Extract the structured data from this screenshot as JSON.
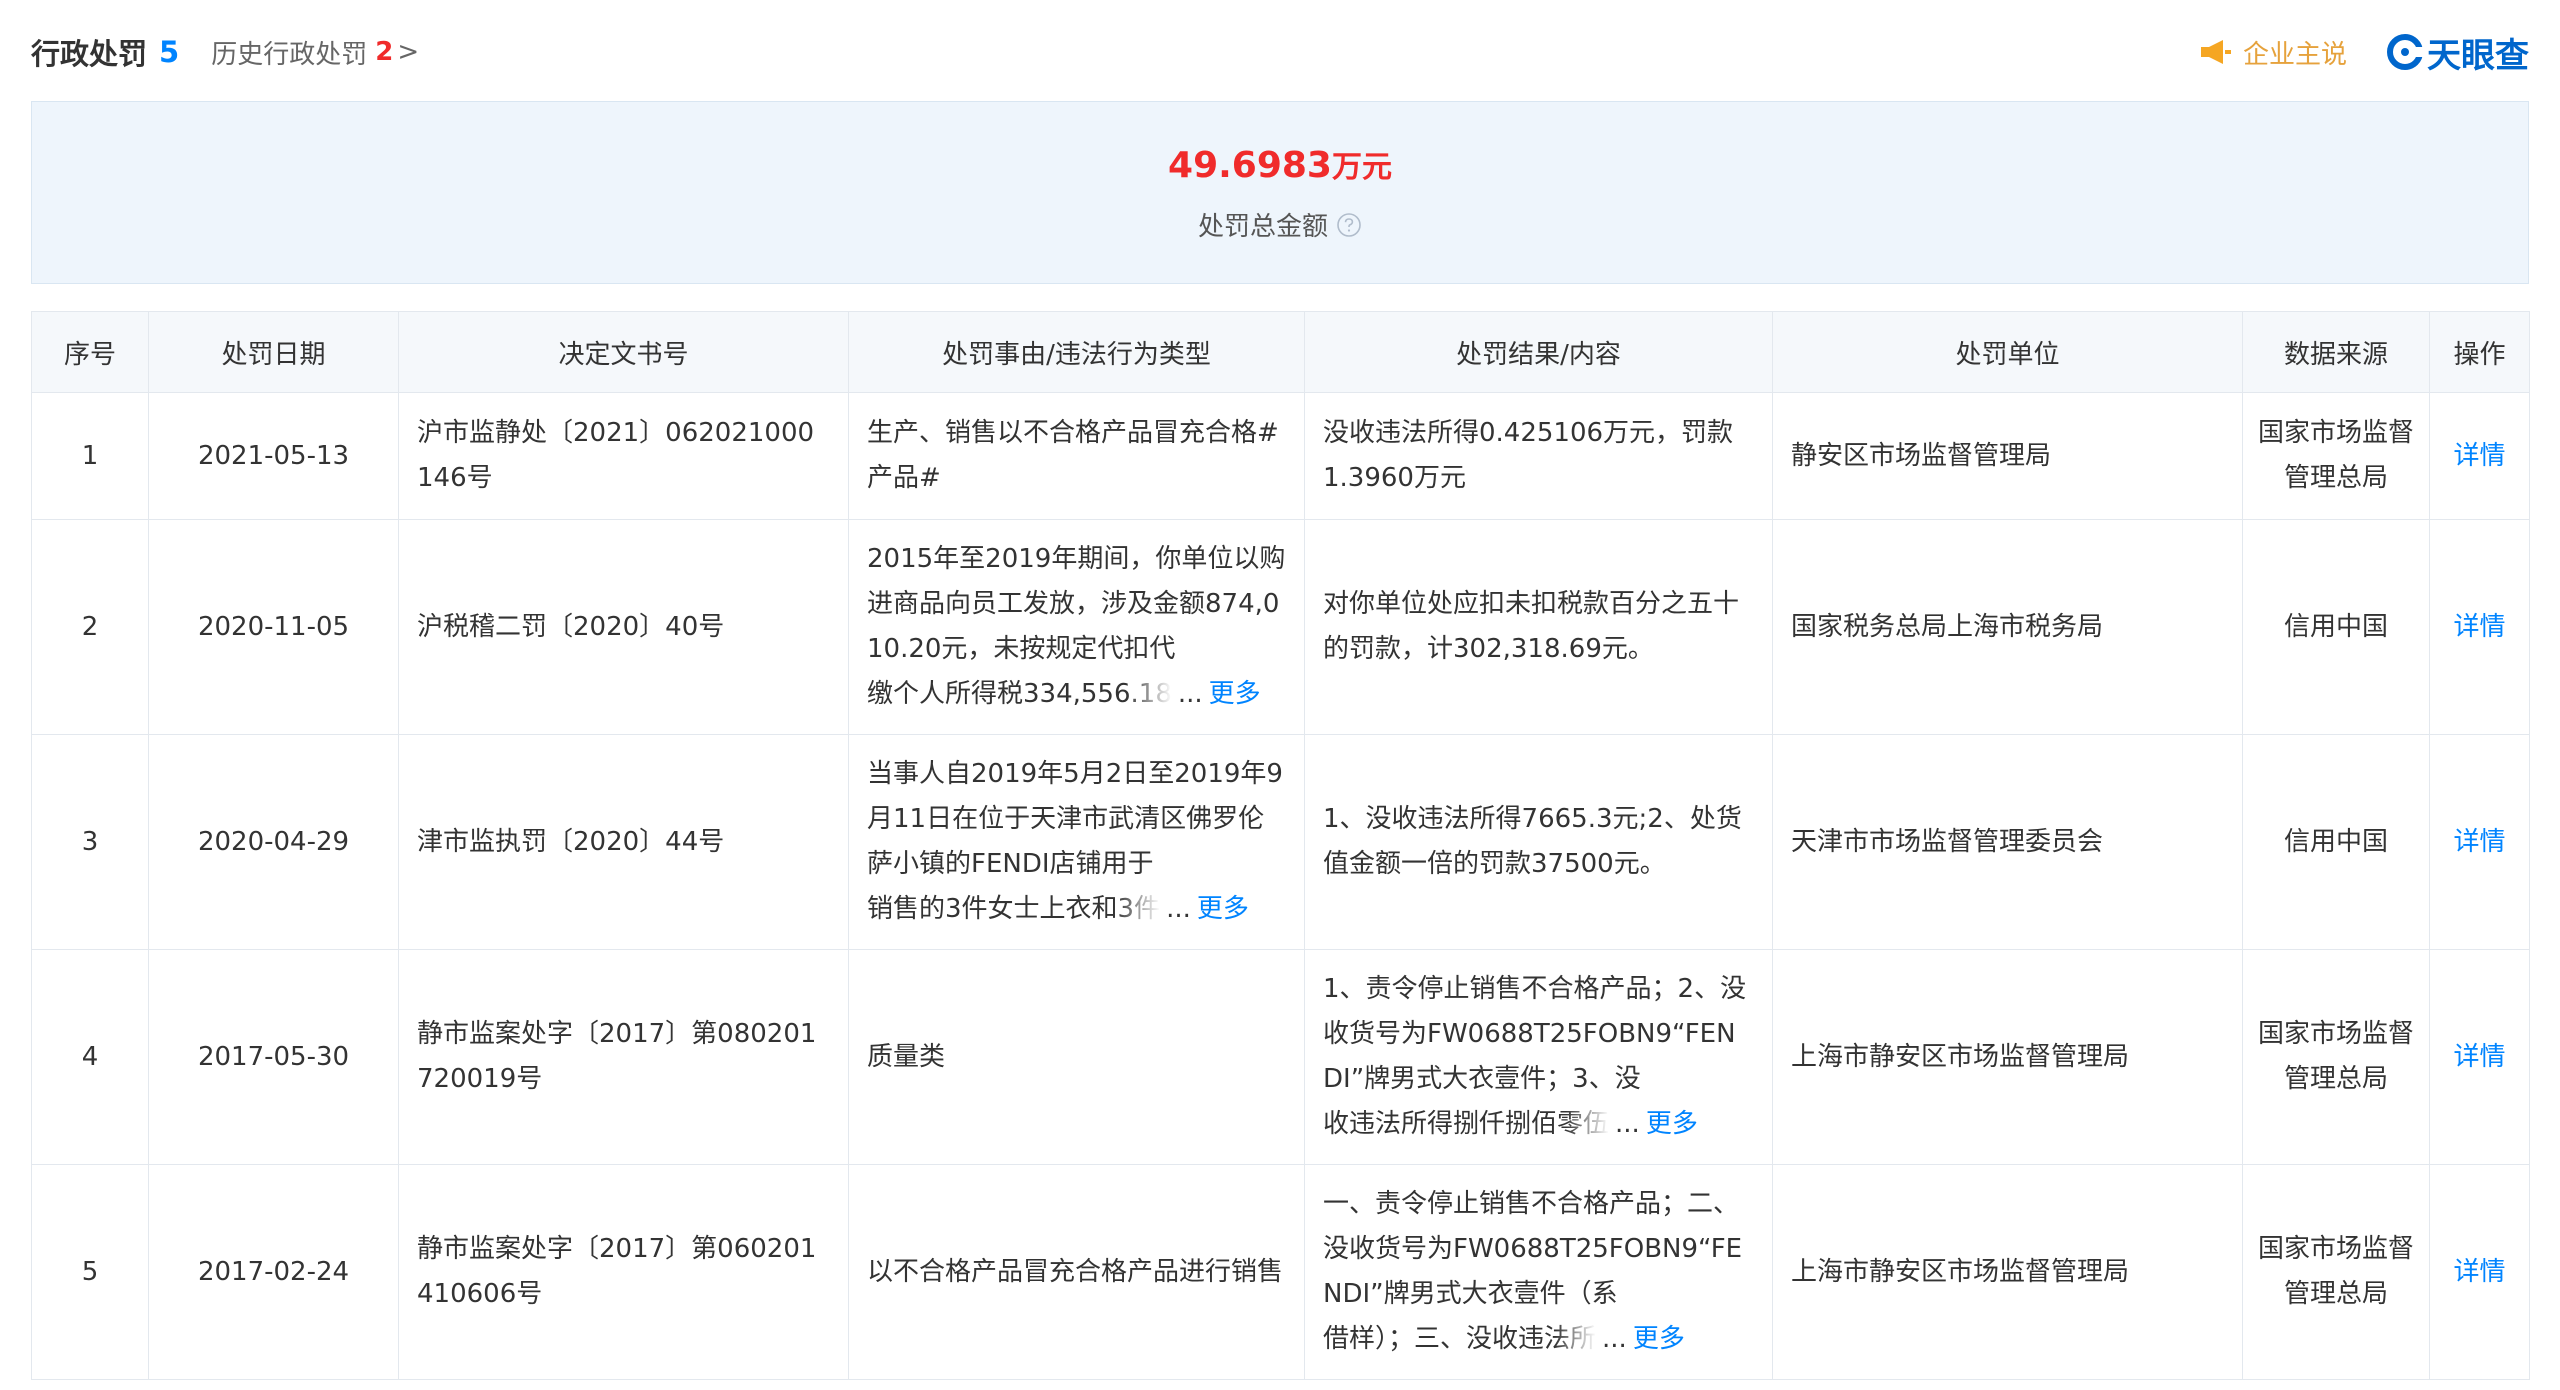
{
  "header": {
    "title": "行政处罚",
    "count": "5",
    "history_label": "历史行政处罚",
    "history_count": "2",
    "history_arrow": ">",
    "enterprise_label": "企业主说",
    "brand_label": "天眼查"
  },
  "summary": {
    "amount": "49.6983",
    "unit": "万元",
    "label": "处罚总金额"
  },
  "table": {
    "columns": [
      "序号",
      "处罚日期",
      "决定文书号",
      "处罚事由/违法行为类型",
      "处罚结果/内容",
      "处罚单位",
      "数据来源",
      "操作"
    ],
    "more_label": "更多",
    "ellipsis": "...",
    "detail_label": "详情",
    "rows": [
      {
        "index": "1",
        "date": "2021-05-13",
        "doc_no": "沪市监静处〔2021〕062021000146号",
        "reason": "生产、销售以不合格产品冒充合格#产品#",
        "reason_tail": "",
        "result": "没收违法所得0.425106万元，罚款1.3960万元",
        "result_tail": "",
        "unit": "静安区市场监督管理局",
        "source": "国家市场监督管理总局"
      },
      {
        "index": "2",
        "date": "2020-11-05",
        "doc_no": "沪税稽二罚〔2020〕40号",
        "reason": "2015年至2019年期间，你单位以购进商品向员工发放，涉及金额874,010.20元，未按规定代扣代",
        "reason_tail": "缴个人所得税334,556.18",
        "result": "对你单位处应扣未扣税款百分之五十的罚款，计302,318.69元。",
        "result_tail": "",
        "unit": "国家税务总局上海市税务局",
        "source": "信用中国"
      },
      {
        "index": "3",
        "date": "2020-04-29",
        "doc_no": "津市监执罚〔2020〕44号",
        "reason": "当事人自2019年5月2日至2019年9月11日在位于天津市武清区佛罗伦萨小镇的FENDI店铺用于",
        "reason_tail": "销售的3件女士上衣和3件",
        "result": "1、没收违法所得7665.3元;2、处货值金额一倍的罚款37500元。",
        "result_tail": "",
        "unit": "天津市市场监督管理委员会",
        "source": "信用中国"
      },
      {
        "index": "4",
        "date": "2017-05-30",
        "doc_no": "静市监案处字〔2017〕第080201720019号",
        "reason": "质量类",
        "reason_tail": "",
        "result": "1、责令停止销售不合格产品；2、没收货号为FW0688T25FOBN9“FENDI”牌男式大衣壹件；3、没",
        "result_tail": "收违法所得捌仟捌佰零伍",
        "unit": "上海市静安区市场监督管理局",
        "source": "国家市场监督管理总局"
      },
      {
        "index": "5",
        "date": "2017-02-24",
        "doc_no": "静市监案处字〔2017〕第060201410606号",
        "reason": "以不合格产品冒充合格产品进行销售",
        "reason_tail": "",
        "result": "一、责令停止销售不合格产品；二、没收货号为FW0688T25FOBN9“FENDI”牌男式大衣壹件（系",
        "result_tail": "借样）；三、没收违法所",
        "unit": "上海市静安区市场监督管理局",
        "source": "国家市场监督管理总局"
      }
    ]
  },
  "colors": {
    "accent": "#0084ff",
    "alert": "#f02b2b",
    "enterprise": "#e6a23c",
    "brand": "#0066cc"
  }
}
